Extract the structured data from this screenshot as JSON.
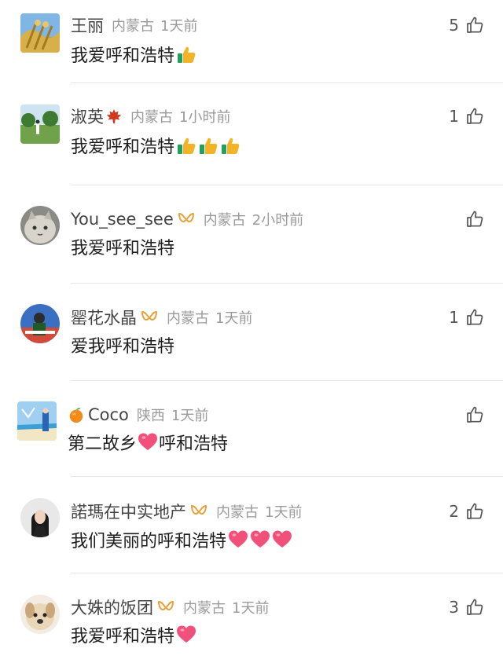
{
  "comments": [
    {
      "username": "王丽",
      "location": "内蒙古",
      "time": "1天前",
      "text": "我爱呼和浩特",
      "likes": "5",
      "emoji": [
        "thumbs-up-icon"
      ]
    },
    {
      "username": "淑英",
      "location": "内蒙古",
      "time": "1小时前",
      "text": "我爱呼和浩特",
      "likes": "1",
      "emoji": [
        "thumbs-up-icon",
        "thumbs-up-icon",
        "thumbs-up-icon"
      ],
      "name_icon": "maple-leaf-icon"
    },
    {
      "username": "You_see_see",
      "location": "内蒙古",
      "time": "2小时前",
      "text": "我爱呼和浩特",
      "likes": "",
      "badge": "vip-badge-icon"
    },
    {
      "username": "罂花水晶",
      "location": "内蒙古",
      "time": "1天前",
      "text": "爱我呼和浩特",
      "likes": "1",
      "badge": "vip-badge-icon"
    },
    {
      "username": "Coco",
      "location": "陕西",
      "time": "1天前",
      "text_before": "第二故乡",
      "text_after": "呼和浩特",
      "likes": "",
      "prefix_icon": "orange-icon",
      "emoji": [
        "heart-icon"
      ]
    },
    {
      "username": "諾瑪在中实地产",
      "location": "内蒙古",
      "time": "1天前",
      "text": "我们美丽的呼和浩特",
      "likes": "2",
      "badge": "vip-badge-icon",
      "emoji": [
        "heart-icon",
        "heart-icon",
        "heart-icon"
      ]
    },
    {
      "username": "大姝的饭团",
      "location": "内蒙古",
      "time": "1天前",
      "text": "我爱呼和浩特",
      "likes": "3",
      "badge": "vip-badge-icon",
      "emoji": [
        "heart-icon"
      ]
    }
  ],
  "colors": {
    "badge_gold": "#e8a23c",
    "heart_pink": "#f0507a",
    "thumb_yellow": "#f2b427",
    "thumb_green": "#22a060",
    "meta_gray": "#9a9a9a",
    "divider": "#e6e6e6"
  }
}
